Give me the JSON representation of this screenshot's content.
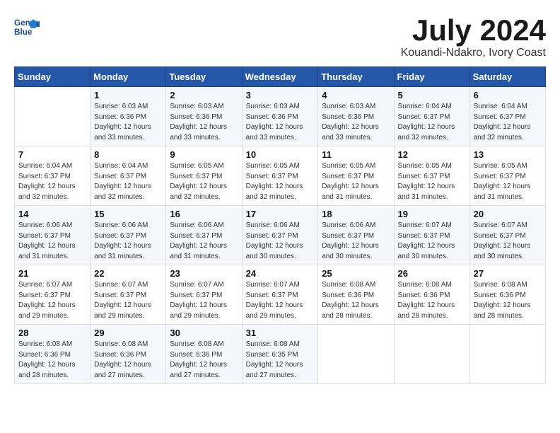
{
  "header": {
    "logo_line1": "General",
    "logo_line2": "Blue",
    "month_title": "July 2024",
    "location": "Kouandi-Ndakro, Ivory Coast"
  },
  "columns": [
    "Sunday",
    "Monday",
    "Tuesday",
    "Wednesday",
    "Thursday",
    "Friday",
    "Saturday"
  ],
  "weeks": [
    [
      {
        "day": "",
        "text": ""
      },
      {
        "day": "1",
        "text": "Sunrise: 6:03 AM\nSunset: 6:36 PM\nDaylight: 12 hours\nand 33 minutes."
      },
      {
        "day": "2",
        "text": "Sunrise: 6:03 AM\nSunset: 6:36 PM\nDaylight: 12 hours\nand 33 minutes."
      },
      {
        "day": "3",
        "text": "Sunrise: 6:03 AM\nSunset: 6:36 PM\nDaylight: 12 hours\nand 33 minutes."
      },
      {
        "day": "4",
        "text": "Sunrise: 6:03 AM\nSunset: 6:36 PM\nDaylight: 12 hours\nand 33 minutes."
      },
      {
        "day": "5",
        "text": "Sunrise: 6:04 AM\nSunset: 6:37 PM\nDaylight: 12 hours\nand 32 minutes."
      },
      {
        "day": "6",
        "text": "Sunrise: 6:04 AM\nSunset: 6:37 PM\nDaylight: 12 hours\nand 32 minutes."
      }
    ],
    [
      {
        "day": "7",
        "text": "Sunrise: 6:04 AM\nSunset: 6:37 PM\nDaylight: 12 hours\nand 32 minutes."
      },
      {
        "day": "8",
        "text": "Sunrise: 6:04 AM\nSunset: 6:37 PM\nDaylight: 12 hours\nand 32 minutes."
      },
      {
        "day": "9",
        "text": "Sunrise: 6:05 AM\nSunset: 6:37 PM\nDaylight: 12 hours\nand 32 minutes."
      },
      {
        "day": "10",
        "text": "Sunrise: 6:05 AM\nSunset: 6:37 PM\nDaylight: 12 hours\nand 32 minutes."
      },
      {
        "day": "11",
        "text": "Sunrise: 6:05 AM\nSunset: 6:37 PM\nDaylight: 12 hours\nand 31 minutes."
      },
      {
        "day": "12",
        "text": "Sunrise: 6:05 AM\nSunset: 6:37 PM\nDaylight: 12 hours\nand 31 minutes."
      },
      {
        "day": "13",
        "text": "Sunrise: 6:05 AM\nSunset: 6:37 PM\nDaylight: 12 hours\nand 31 minutes."
      }
    ],
    [
      {
        "day": "14",
        "text": "Sunrise: 6:06 AM\nSunset: 6:37 PM\nDaylight: 12 hours\nand 31 minutes."
      },
      {
        "day": "15",
        "text": "Sunrise: 6:06 AM\nSunset: 6:37 PM\nDaylight: 12 hours\nand 31 minutes."
      },
      {
        "day": "16",
        "text": "Sunrise: 6:06 AM\nSunset: 6:37 PM\nDaylight: 12 hours\nand 31 minutes."
      },
      {
        "day": "17",
        "text": "Sunrise: 6:06 AM\nSunset: 6:37 PM\nDaylight: 12 hours\nand 30 minutes."
      },
      {
        "day": "18",
        "text": "Sunrise: 6:06 AM\nSunset: 6:37 PM\nDaylight: 12 hours\nand 30 minutes."
      },
      {
        "day": "19",
        "text": "Sunrise: 6:07 AM\nSunset: 6:37 PM\nDaylight: 12 hours\nand 30 minutes."
      },
      {
        "day": "20",
        "text": "Sunrise: 6:07 AM\nSunset: 6:37 PM\nDaylight: 12 hours\nand 30 minutes."
      }
    ],
    [
      {
        "day": "21",
        "text": "Sunrise: 6:07 AM\nSunset: 6:37 PM\nDaylight: 12 hours\nand 29 minutes."
      },
      {
        "day": "22",
        "text": "Sunrise: 6:07 AM\nSunset: 6:37 PM\nDaylight: 12 hours\nand 29 minutes."
      },
      {
        "day": "23",
        "text": "Sunrise: 6:07 AM\nSunset: 6:37 PM\nDaylight: 12 hours\nand 29 minutes."
      },
      {
        "day": "24",
        "text": "Sunrise: 6:07 AM\nSunset: 6:37 PM\nDaylight: 12 hours\nand 29 minutes."
      },
      {
        "day": "25",
        "text": "Sunrise: 6:08 AM\nSunset: 6:36 PM\nDaylight: 12 hours\nand 28 minutes."
      },
      {
        "day": "26",
        "text": "Sunrise: 6:08 AM\nSunset: 6:36 PM\nDaylight: 12 hours\nand 28 minutes."
      },
      {
        "day": "27",
        "text": "Sunrise: 6:08 AM\nSunset: 6:36 PM\nDaylight: 12 hours\nand 28 minutes."
      }
    ],
    [
      {
        "day": "28",
        "text": "Sunrise: 6:08 AM\nSunset: 6:36 PM\nDaylight: 12 hours\nand 28 minutes."
      },
      {
        "day": "29",
        "text": "Sunrise: 6:08 AM\nSunset: 6:36 PM\nDaylight: 12 hours\nand 27 minutes."
      },
      {
        "day": "30",
        "text": "Sunrise: 6:08 AM\nSunset: 6:36 PM\nDaylight: 12 hours\nand 27 minutes."
      },
      {
        "day": "31",
        "text": "Sunrise: 6:08 AM\nSunset: 6:35 PM\nDaylight: 12 hours\nand 27 minutes."
      },
      {
        "day": "",
        "text": ""
      },
      {
        "day": "",
        "text": ""
      },
      {
        "day": "",
        "text": ""
      }
    ]
  ]
}
